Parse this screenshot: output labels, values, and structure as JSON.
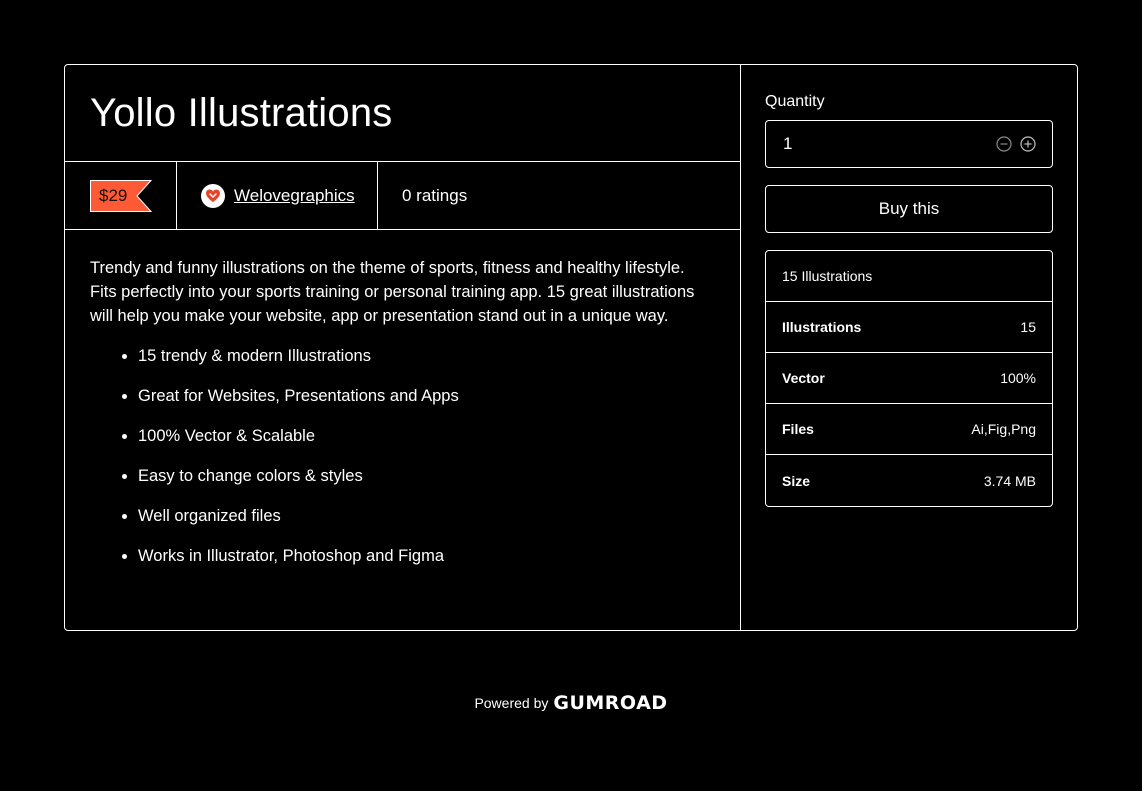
{
  "product": {
    "title": "Yollo Illustrations",
    "price": "$29",
    "creator": "Welovegraphics",
    "ratings": "0 ratings"
  },
  "description": {
    "intro": "Trendy and funny illustrations on the theme of sports, fitness and healthy lifestyle. Fits perfectly into your sports training or personal training app. 15 great illustrations will help you make your website, app or presentation stand out in a unique way.",
    "bullets": [
      "15 trendy & modern Illustrations",
      "Great for Websites, Presentations and Apps",
      "100% Vector & Scalable",
      "Easy to change colors & styles",
      "Well organized files",
      "Works in Illustrator, Photoshop and Figma"
    ]
  },
  "purchase": {
    "quantity_label": "Quantity",
    "quantity_value": "1",
    "buy_label": "Buy this"
  },
  "info_table": {
    "header": "15 Illustrations",
    "rows": [
      {
        "key": "Illustrations",
        "value": "15"
      },
      {
        "key": "Vector",
        "value": "100%"
      },
      {
        "key": "Files",
        "value": "Ai,Fig,Png"
      },
      {
        "key": "Size",
        "value": "3.74 MB"
      }
    ]
  },
  "footer": {
    "powered_by": "Powered by",
    "brand": "GUMROAD"
  },
  "icons": {
    "price_tag": "price-tag-icon",
    "avatar": "heart-icon",
    "decrement": "minus-circle-icon",
    "increment": "plus-circle-icon"
  },
  "colors": {
    "background": "#000000",
    "foreground": "#ffffff",
    "price_tag": "#ff5a36",
    "heart": "#e8432b"
  }
}
